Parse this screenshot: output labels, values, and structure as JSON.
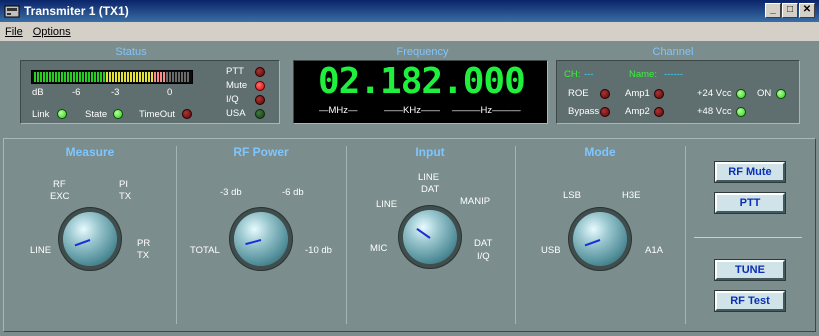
{
  "window": {
    "title": "Transmiter 1  (TX1)",
    "min_icon": "minimize-icon",
    "max_icon": "maximize-icon",
    "close_icon": "close-icon"
  },
  "menu": {
    "file": "File",
    "options": "Options"
  },
  "status": {
    "title": "Status",
    "meter_labels": {
      "db": "dB",
      "m6": "-6",
      "m3": "-3",
      "zero": "0"
    },
    "ptt": "PTT",
    "mute": "Mute",
    "iq": "I/Q",
    "usa": "USA",
    "link": "Link",
    "state": "State",
    "timeout": "TimeOut"
  },
  "frequency": {
    "title": "Frequency",
    "value": "02.182.000",
    "mhz": "MHz",
    "khz": "KHz",
    "hz": "Hz"
  },
  "channel": {
    "title": "Channel",
    "ch_label": "CH:",
    "ch_value": "---",
    "name_label": "Name:",
    "name_value": "------",
    "roe": "ROE",
    "bypass": "Bypass",
    "amp1": "Amp1",
    "amp2": "Amp2",
    "v24": "+24 Vcc",
    "v48": "+48 Vcc",
    "on": "ON"
  },
  "measure": {
    "title": "Measure",
    "line": "LINE",
    "rf": "RF",
    "exc": "EXC",
    "pi": "PI",
    "tx1": "TX",
    "pr": "PR",
    "tx2": "TX"
  },
  "rfpower": {
    "title": "RF Power",
    "total": "TOTAL",
    "m3db": "-3 db",
    "m6db": "-6 db",
    "m10db": "-10 db"
  },
  "input": {
    "title": "Input",
    "mic": "MIC",
    "line": "LINE",
    "line2": "LINE",
    "dat": "DAT",
    "manip": "MANIP",
    "dat2": "DAT",
    "iq": "I/Q"
  },
  "mode": {
    "title": "Mode",
    "usb": "USB",
    "lsb": "LSB",
    "h3e": "H3E",
    "a1a": "A1A"
  },
  "buttons": {
    "rf_mute": "RF Mute",
    "ptt": "PTT",
    "tune": "TUNE",
    "rf_test": "RF Test"
  },
  "colors": {
    "led_green": "#2fce1f",
    "led_red": "#e00000",
    "freq_digits": "#1ff03d",
    "section_title": "#7fc6ff"
  }
}
